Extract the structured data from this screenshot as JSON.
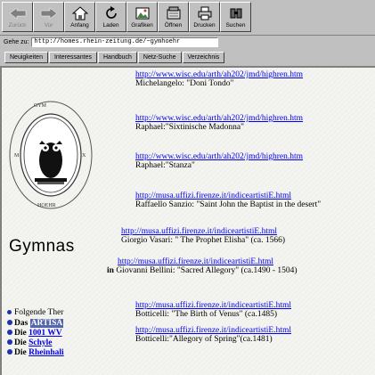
{
  "toolbar": {
    "buttons": [
      {
        "label": "Zurück",
        "icon": "back-arrow-icon"
      },
      {
        "label": "Vor",
        "icon": "forward-arrow-icon"
      },
      {
        "label": "Anfang",
        "icon": "home-icon"
      },
      {
        "label": "Laden",
        "icon": "reload-icon"
      },
      {
        "label": "Grafiken",
        "icon": "images-icon"
      },
      {
        "label": "Öffnen",
        "icon": "open-icon"
      },
      {
        "label": "Drucken",
        "icon": "print-icon"
      },
      {
        "label": "Suchen",
        "icon": "search-icon"
      }
    ]
  },
  "address": {
    "label": "Gehe zu:",
    "value": "http://homes.rhein-zeitung.de/~gymhoehr"
  },
  "directory_buttons": [
    "Neuigkeiten",
    "Interessantes",
    "Handbuch",
    "Netz-Suche",
    "Verzeichnis"
  ],
  "entries": [
    {
      "url": "http://www.wisc.edu/arth/ah202/jmd/highren.htm",
      "desc": "Michelangelo: \"Doni Tondo\""
    },
    {
      "url": "http://www.wisc.edu/arth/ah202/jmd/highren.htm",
      "desc": "Raphael:\"Sixtinische Madonna\""
    },
    {
      "url": "http://www.wisc.edu/arth/ah202/jmd/highren.htm",
      "desc": "Raphael:\"Stanza\""
    },
    {
      "url": "http://musa.uffizi.firenze.it/indiceartistiE.html",
      "desc": "Raffaello Sanzio: \"Saint John the Baptist in the desert\""
    },
    {
      "url": "http://musa.uffizi.firenze.it/indiceartistiE.html",
      "desc": "Giorgio Vasari: \" The Prophet Elisha\" (ca. 1566)"
    },
    {
      "url": "http://musa.uffizi.firenze.it/indiceartistiE.html",
      "desc": "Giovanni Bellini: \"Sacred Allegory\" (ca.1490 - 1504)"
    },
    {
      "url": "http://musa.uffizi.firenze.it/indiceartistiE.html",
      "desc": "Botticelli: \"The Birth of Venus\" (ca.1485)"
    },
    {
      "url": "http://musa.uffizi.firenze.it/indiceartistiE.html",
      "desc": "Botticelli:\"Allegory of Spring\"(ca.1481)"
    }
  ],
  "school_name": "Gymnas",
  "in_prefix": "in",
  "side": {
    "intro": "Folgende Ther",
    "items": [
      {
        "pre": "Das",
        "hl": "ARTISA"
      },
      {
        "pre": "Die",
        "hl": "1001 WV"
      },
      {
        "pre": "Die",
        "hl": "Schyle"
      },
      {
        "pre": "Die",
        "hl": "Rheinhali"
      }
    ]
  },
  "colors": {
    "link": "#0000ee",
    "chrome": "#c0c0c0",
    "page": "#f2f2ee"
  }
}
